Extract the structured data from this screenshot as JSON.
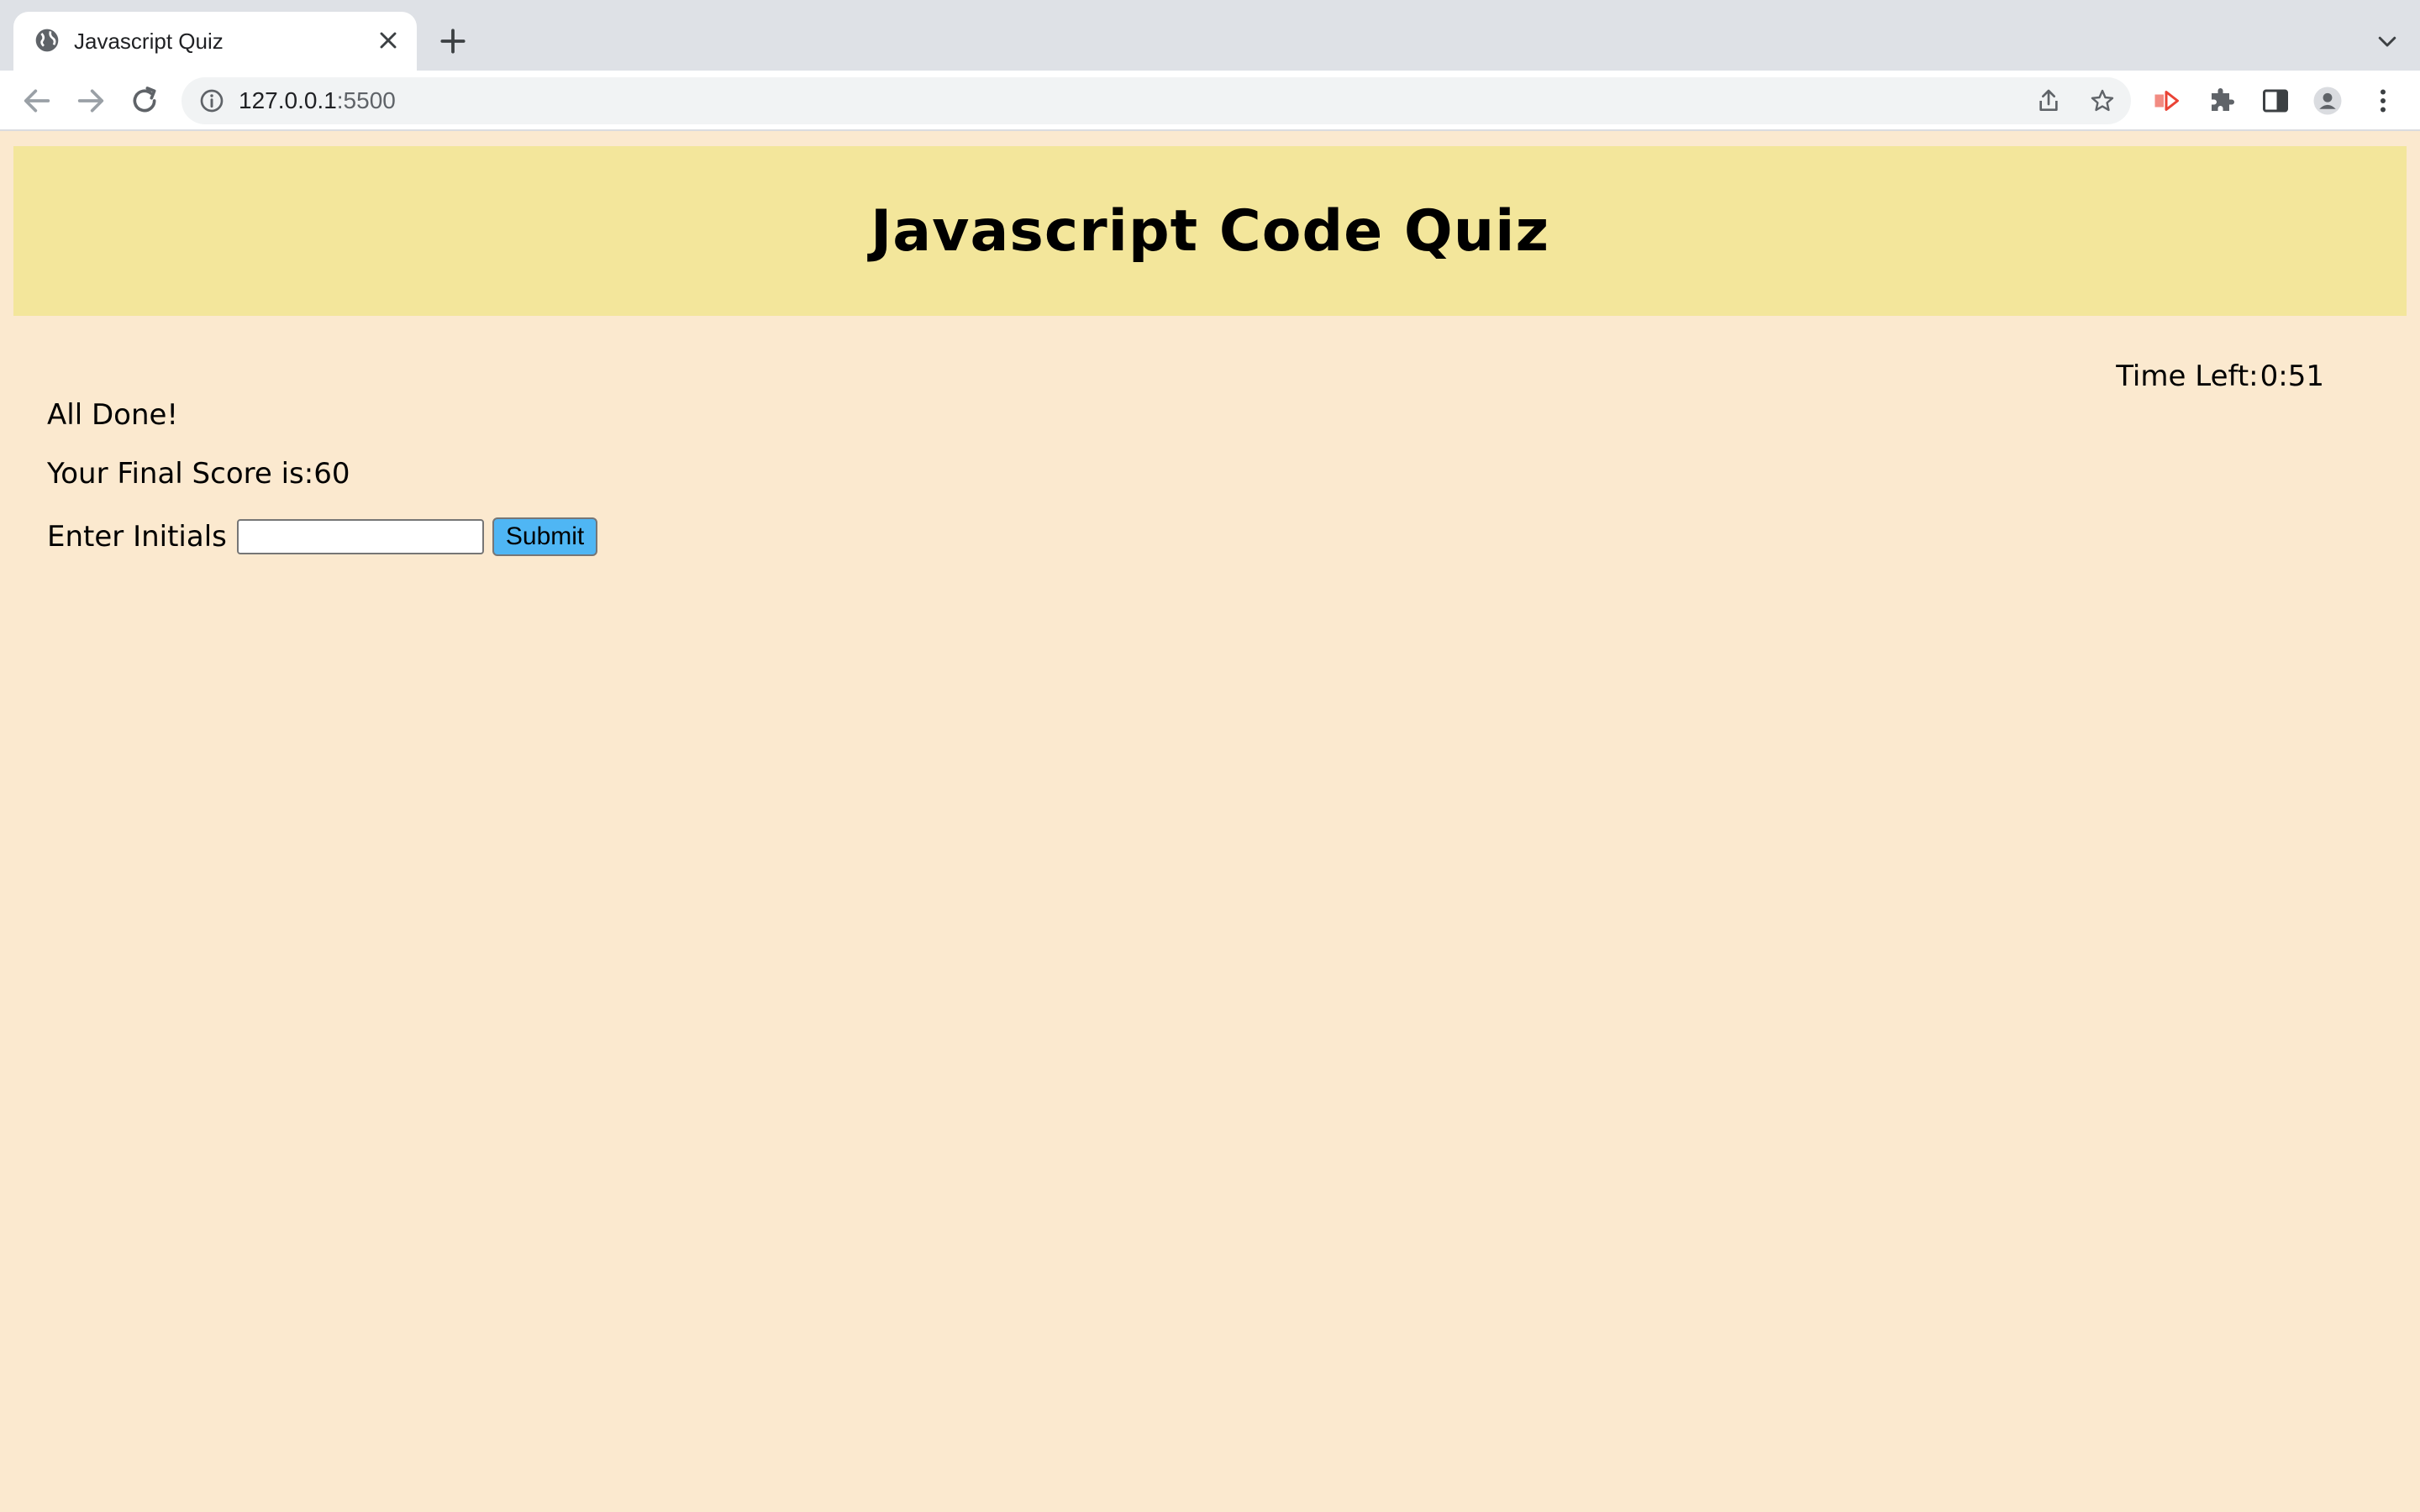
{
  "browser": {
    "tab": {
      "title": "Javascript Quiz"
    },
    "address_bar": {
      "host": "127.0.0.1",
      "port": ":5500"
    }
  },
  "page": {
    "header": {
      "title": "Javascript Code Quiz"
    },
    "timer": {
      "label": "Time Left:",
      "value": "0:51"
    },
    "results": {
      "done_text": "All Done!",
      "score_label": "Your Final Score is:",
      "score_value": "60"
    },
    "initials_form": {
      "label": "Enter Initials",
      "input_value": "",
      "input_placeholder": "",
      "submit_label": "Submit"
    }
  },
  "colors": {
    "page_background": "#fbe9cf",
    "header_background": "#f3e69b",
    "submit_button": "#4fb6f4"
  }
}
